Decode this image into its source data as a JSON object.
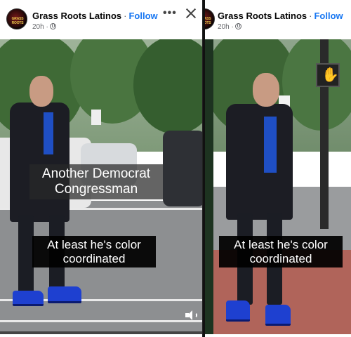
{
  "left_post": {
    "page_name": "Grass Roots Latinos",
    "separator": "·",
    "follow_label": "Follow",
    "time_ago": "20h ·",
    "more_label": "•••",
    "avatar_text": "GRASS ROOTS",
    "captions": {
      "top_line1": "Another Democrat",
      "top_line2": "Congressman",
      "bottom_line1": "At least he's color",
      "bottom_line2": "coordinated"
    },
    "progress": 0.0
  },
  "right_post": {
    "page_name": "Grass Roots Latinos",
    "separator": "·",
    "follow_label": "Follow",
    "time_ago": "20h ·",
    "avatar_text": "GRASS ROOTS",
    "captions": {
      "bottom_line1": "At least he's color",
      "bottom_line2": "coordinated"
    }
  },
  "icons": {
    "more": "more-options-icon",
    "close": "close-icon",
    "globe": "globe-icon",
    "speaker": "speaker-icon",
    "pedestrian_signal": "stop-hand-icon"
  },
  "colors": {
    "follow": "#1877f2",
    "shirt": "#1f4fc4",
    "heels": "#1e40d0",
    "caption_bg": "#000000"
  }
}
